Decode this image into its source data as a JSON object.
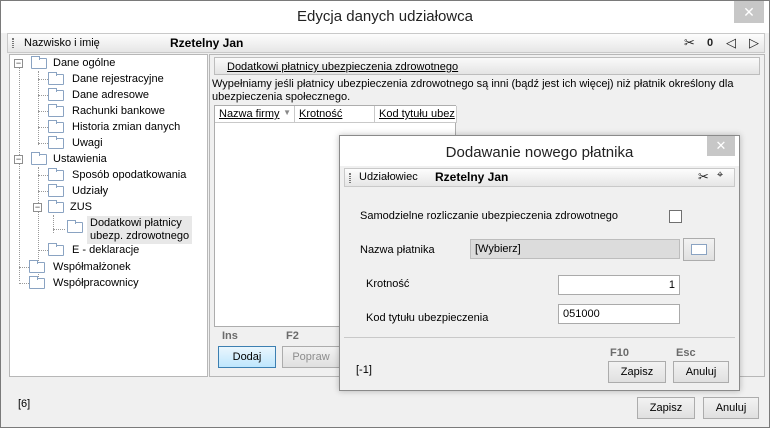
{
  "window": {
    "title": "Edycja danych udziałowca",
    "close_glyph": "✕"
  },
  "header": {
    "label": "Nazwisko i imię",
    "value": "Rzetelny Jan"
  },
  "tree": {
    "items": [
      {
        "label": "Dane ogólne"
      },
      {
        "label": "Dane rejestracyjne"
      },
      {
        "label": "Dane adresowe"
      },
      {
        "label": "Rachunki bankowe"
      },
      {
        "label": "Historia zmian danych"
      },
      {
        "label": "Uwagi"
      },
      {
        "label": "Ustawienia"
      },
      {
        "label": "Sposób opodatkowania"
      },
      {
        "label": "Udziały"
      },
      {
        "label": "ZUS"
      },
      {
        "label": "Dodatkowi płatnicy"
      },
      {
        "label": "ubezp. zdrowotnego"
      },
      {
        "label": "E - deklaracje"
      },
      {
        "label": "Współmałżonek"
      },
      {
        "label": "Współpracownicy"
      }
    ],
    "expander_minus": "−"
  },
  "section": {
    "tab_label": "Dodatkowi płatnicy ubezpieczenia zdrowotnego",
    "description": "Wypełniamy jeśli płatnicy ubezpieczenia zdrowotnego są inni (bądź jest ich więcej) niż płatnik określony dla ubezpieczenia społecznego."
  },
  "grid": {
    "columns": [
      "Nazwa firmy",
      "Krotność",
      "Kod tytułu ubez"
    ]
  },
  "footer": {
    "add_key": "Ins",
    "add_label": "Dodaj",
    "edit_key": "F2",
    "edit_label": "Popraw"
  },
  "status_count": "[6]",
  "main_buttons": {
    "save": "Zapisz",
    "cancel": "Anuluj"
  },
  "dialog": {
    "title": "Dodawanie nowego płatnika",
    "close_glyph": "✕",
    "header_label": "Udziałowiec",
    "header_value": "Rzetelny Jan",
    "self_settlement_label": "Samodzielne rozliczanie ubezpieczenia zdrowotnego",
    "payer_label": "Nazwa płatnika",
    "payer_value": "[Wybierz]",
    "multiplicity_label": "Krotność",
    "multiplicity_value": "1",
    "code_label": "Kod tytułu ubezpieczenia",
    "code_value": "051000",
    "status": "[-1]",
    "save_key": "F10",
    "save_label": "Zapisz",
    "cancel_key": "Esc",
    "cancel_label": "Anuluj"
  },
  "icons": {
    "scissors": "✂",
    "paperclip": "🖇",
    "prev": "◁",
    "next": "▷",
    "pin": "⌖"
  }
}
